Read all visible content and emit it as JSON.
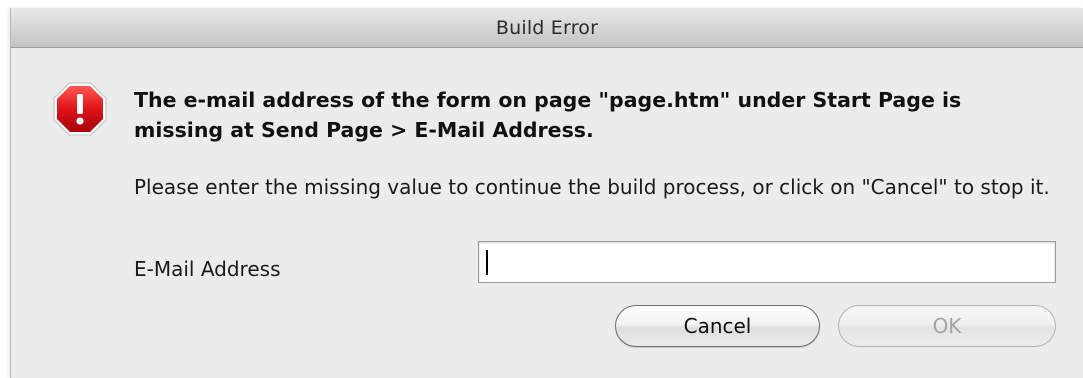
{
  "window": {
    "title": "Build Error"
  },
  "alert": {
    "icon": "stop-octagon-icon",
    "icon_color": "#d0111b",
    "headline": "The e-mail address of the form on page \"page.htm\" under Start Page is missing at Send Page > E-Mail Address.",
    "message": "Please enter the missing value to continue the build process, or click on \"Cancel\" to stop it."
  },
  "form": {
    "email_label": "E-Mail Address",
    "email_value": "",
    "email_placeholder": ""
  },
  "buttons": {
    "cancel_label": "Cancel",
    "ok_label": "OK",
    "ok_enabled": false
  }
}
